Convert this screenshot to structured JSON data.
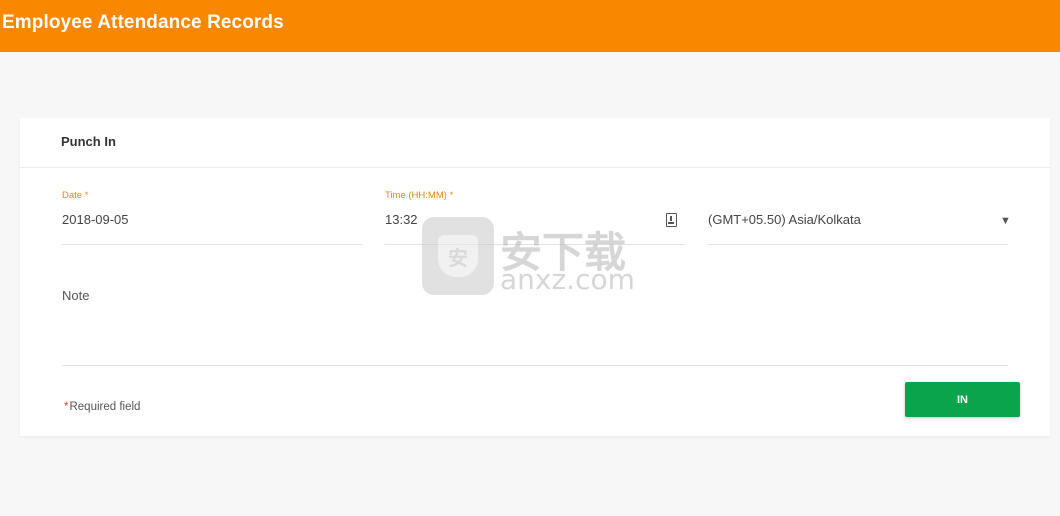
{
  "header": {
    "title": "Employee Attendance Records",
    "color": "#fa8700"
  },
  "form": {
    "heading": "Punch In",
    "date": {
      "label": "Date",
      "required_mark": "*",
      "value": "2018-09-05"
    },
    "time": {
      "label": "Time (HH:MM)",
      "required_mark": "*",
      "value": "13:32",
      "icon": "clock-icon"
    },
    "timezone": {
      "value": "(GMT+05.50) Asia/Kolkata",
      "chevron": "▼"
    },
    "note": {
      "label": "Note",
      "value": ""
    },
    "required_note": {
      "mark": "*",
      "text": "Required field"
    },
    "submit": {
      "label": "IN",
      "color": "#0aa44c"
    }
  },
  "watermark": {
    "cn": "安下载",
    "en": "anxz.com",
    "badge": "安"
  }
}
